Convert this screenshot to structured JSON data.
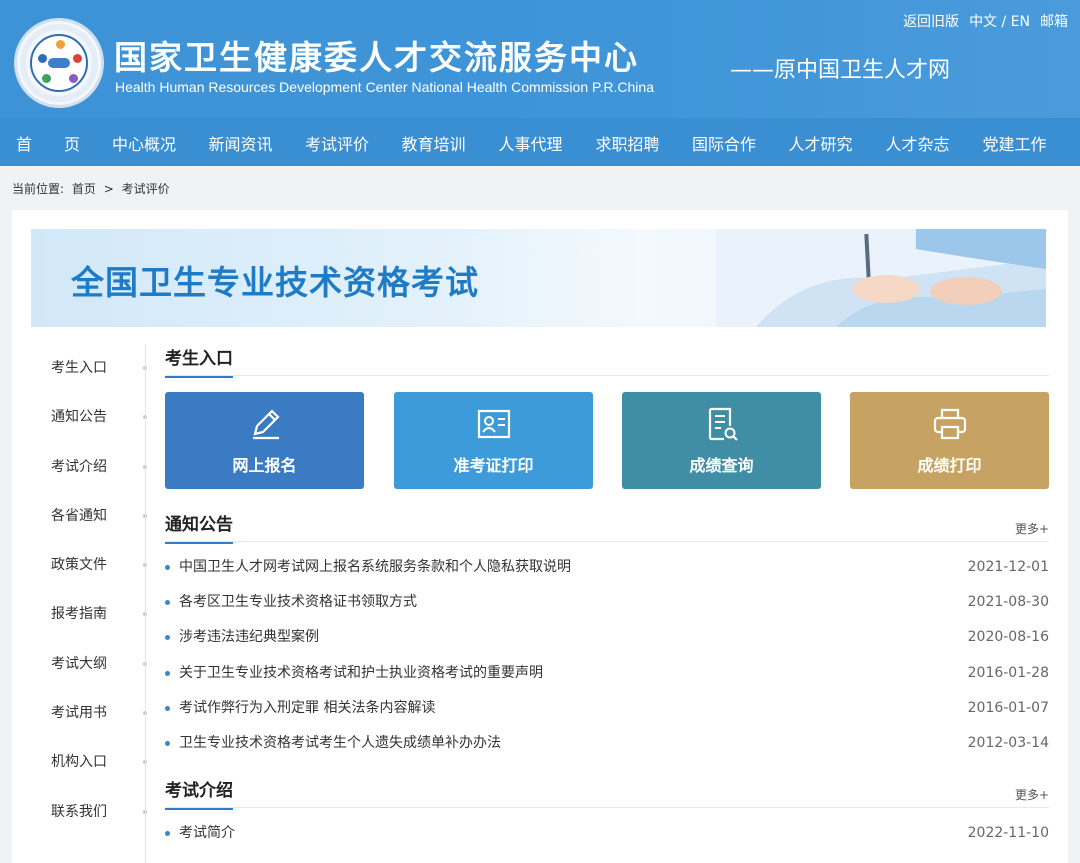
{
  "header": {
    "title": "国家卫生健康委人才交流服务中心",
    "subtitle_en": "Health Human Resources Development Center National Health Commission P.R.China",
    "former_name": "——原中国卫生人才网",
    "top_links": [
      "返回旧版",
      "中文 / EN",
      "邮箱"
    ],
    "bg_color": "#3a8fd2"
  },
  "nav": {
    "items": [
      "首　　页",
      "中心概况",
      "新闻资讯",
      "考试评价",
      "教育培训",
      "人事代理",
      "求职招聘",
      "国际合作",
      "人才研究",
      "人才杂志",
      "党建工作"
    ]
  },
  "breadcrumb": {
    "label": "当前位置:",
    "home": "首页",
    "sep": ">",
    "current": "考试评价"
  },
  "banner": {
    "title": "全国卫生专业技术资格考试"
  },
  "side_menu": {
    "items": [
      "考生入口",
      "通知公告",
      "考试介绍",
      "各省通知",
      "政策文件",
      "报考指南",
      "考试大纲",
      "考试用书",
      "机构入口",
      "联系我们"
    ]
  },
  "entry": {
    "title": "考生入口",
    "tiles": [
      {
        "label": "网上报名",
        "icon": "pen-icon",
        "color": "#3b7bc4"
      },
      {
        "label": "准考证打印",
        "icon": "id-card-icon",
        "color": "#3e9bd9"
      },
      {
        "label": "成绩查询",
        "icon": "document-search-icon",
        "color": "#3f8ea6"
      },
      {
        "label": "成绩打印",
        "icon": "printer-icon",
        "color": "#c7a363"
      }
    ]
  },
  "notices": {
    "title": "通知公告",
    "more": "更多+",
    "items": [
      {
        "text": "中国卫生人才网考试网上报名系统服务条款和个人隐私获取说明",
        "date": "2021-12-01"
      },
      {
        "text": "各考区卫生专业技术资格证书领取方式",
        "date": "2021-08-30"
      },
      {
        "text": "涉考违法违纪典型案例",
        "date": "2020-08-16"
      },
      {
        "text": "关于卫生专业技术资格考试和护士执业资格考试的重要声明",
        "date": "2016-01-28"
      },
      {
        "text": "考试作弊行为入刑定罪 相关法条内容解读",
        "date": "2016-01-07"
      },
      {
        "text": "卫生专业技术资格考试考生个人遗失成绩单补办办法",
        "date": "2012-03-14"
      }
    ]
  },
  "intro": {
    "title": "考试介绍",
    "more": "更多+",
    "items": [
      {
        "text": "考试简介",
        "date": "2022-11-10"
      }
    ]
  }
}
